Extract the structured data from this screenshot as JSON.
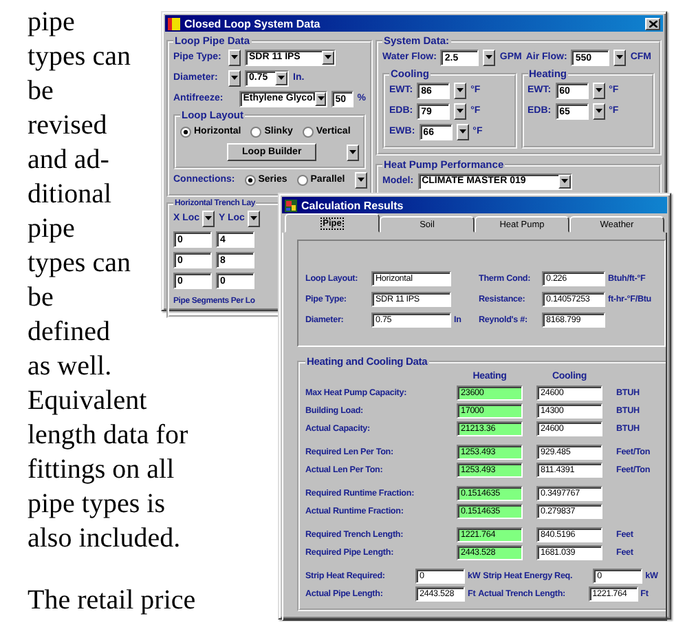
{
  "article": {
    "sentences": [
      "pipe types can be revised and ad-ditional pipe types can be defined as well.",
      "Equivalent length data for fittings on all pipe types is also included.",
      "The retail price"
    ]
  },
  "system_window": {
    "title": "Closed Loop System Data",
    "loop_pipe_data": {
      "title": "Loop Pipe Data",
      "pipe_type": {
        "label": "Pipe Type:",
        "value": "SDR 11 IPS"
      },
      "diameter": {
        "label": "Diameter:",
        "value": "0.75",
        "unit": "In."
      },
      "antifreeze": {
        "label": "Antifreeze:",
        "value": "Ethylene Glycol",
        "percent": "50",
        "unit": "%"
      },
      "loop_layout": {
        "title": "Loop Layout",
        "options": [
          {
            "label": "Horizontal",
            "selected": true
          },
          {
            "label": "Slinky",
            "selected": false
          },
          {
            "label": "Vertical",
            "selected": false
          }
        ],
        "button": "Loop Builder"
      },
      "connections": {
        "label": "Connections:",
        "options": [
          {
            "label": "Series",
            "selected": true
          },
          {
            "label": "Parallel",
            "selected": false
          }
        ]
      }
    },
    "trench_layout": {
      "title": "Horizontal Trench Lay",
      "columns": [
        "X Loc",
        "Y Loc"
      ],
      "rows": [
        [
          "0",
          "4"
        ],
        [
          "0",
          "8"
        ],
        [
          "0",
          "0"
        ]
      ],
      "footer": "Pipe Segments Per Lo"
    },
    "system_data": {
      "title": "System Data:",
      "water_flow": {
        "label": "Water Flow:",
        "value": "2.5",
        "unit": "GPM"
      },
      "air_flow": {
        "label": "Air Flow:",
        "value": "550",
        "unit": "CFM"
      },
      "groups": [
        {
          "title": "Cooling",
          "rows": [
            {
              "label": "EWT:",
              "value": "86",
              "unit": "°F"
            },
            {
              "label": "EDB:",
              "value": "79",
              "unit": "°F"
            },
            {
              "label": "EWB:",
              "value": "66",
              "unit": "°F"
            }
          ]
        },
        {
          "title": "Heating",
          "rows": [
            {
              "label": "EWT:",
              "value": "60",
              "unit": "°F"
            },
            {
              "label": "EDB:",
              "value": "65",
              "unit": "°F"
            }
          ]
        }
      ]
    },
    "heat_pump": {
      "title": "Heat Pump Performance",
      "model": {
        "label": "Model:",
        "value": "CLIMATE MASTER 019"
      }
    }
  },
  "results_window": {
    "title": "Calculation Results",
    "tabs": [
      {
        "label": "Pipe",
        "selected": true
      },
      {
        "label": "Soil",
        "selected": false
      },
      {
        "label": "Heat Pump",
        "selected": false
      },
      {
        "label": "Weather",
        "selected": false
      }
    ],
    "pipe_rows": [
      {
        "left": {
          "label": "Loop Layout:",
          "value": "Horizontal"
        },
        "right": {
          "label": "Therm Cond:",
          "value": "0.226",
          "unit": "Btuh/ft-°F"
        }
      },
      {
        "left": {
          "label": "Pipe Type:",
          "value": "SDR 11 IPS"
        },
        "right": {
          "label": "Resistance:",
          "value": "0.14057253",
          "unit": "ft-hr-°F/Btu"
        }
      },
      {
        "left": {
          "label": "Diameter:",
          "value": "0.75",
          "unit": "In"
        },
        "right": {
          "label": "Reynold's #:",
          "value": "8168.799"
        }
      }
    ],
    "heating_cooling": {
      "title": "Heating and Cooling Data",
      "columns": [
        "Heating",
        "Cooling"
      ],
      "groups": [
        [
          {
            "label": "Max Heat Pump Capacity:",
            "heating": "23600",
            "cooling": "24600",
            "unit": "BTUH"
          },
          {
            "label": "Building Load:",
            "heating": "17000",
            "cooling": "14300",
            "unit": "BTUH"
          },
          {
            "label": "Actual Capacity:",
            "heating": "21213.36",
            "cooling": "24600",
            "unit": "BTUH"
          }
        ],
        [
          {
            "label": "Required Len Per Ton:",
            "heating": "1253.493",
            "cooling": "929.485",
            "unit": "Feet/Ton"
          },
          {
            "label": "Actual Len Per Ton:",
            "heating": "1253.493",
            "cooling": "811.4391",
            "unit": "Feet/Ton"
          }
        ],
        [
          {
            "label": "Required Runtime Fraction:",
            "heating": "0.1514635",
            "cooling": "0.3497767"
          },
          {
            "label": "Actual Runtime Fraction:",
            "heating": "0.1514635",
            "cooling": "0.279837"
          }
        ],
        [
          {
            "label": "Required Trench Length:",
            "heating": "1221.764",
            "cooling": "840.5196",
            "unit": "Feet"
          },
          {
            "label": "Required Pipe Length:",
            "heating": "2443.528",
            "cooling": "1681.039",
            "unit": "Feet"
          }
        ]
      ],
      "extra_rows": [
        [
          {
            "label": "Strip Heat Required:",
            "value": "0",
            "unit": "kW"
          },
          {
            "label": "Strip Heat Energy Req.",
            "value": "0",
            "unit": "kW"
          }
        ],
        [
          {
            "label": "Actual Pipe Length:",
            "value": "2443.528",
            "unit": "Ft"
          },
          {
            "label": "Actual Trench Length:",
            "value": "1221.764",
            "unit": "Ft"
          }
        ]
      ]
    }
  }
}
